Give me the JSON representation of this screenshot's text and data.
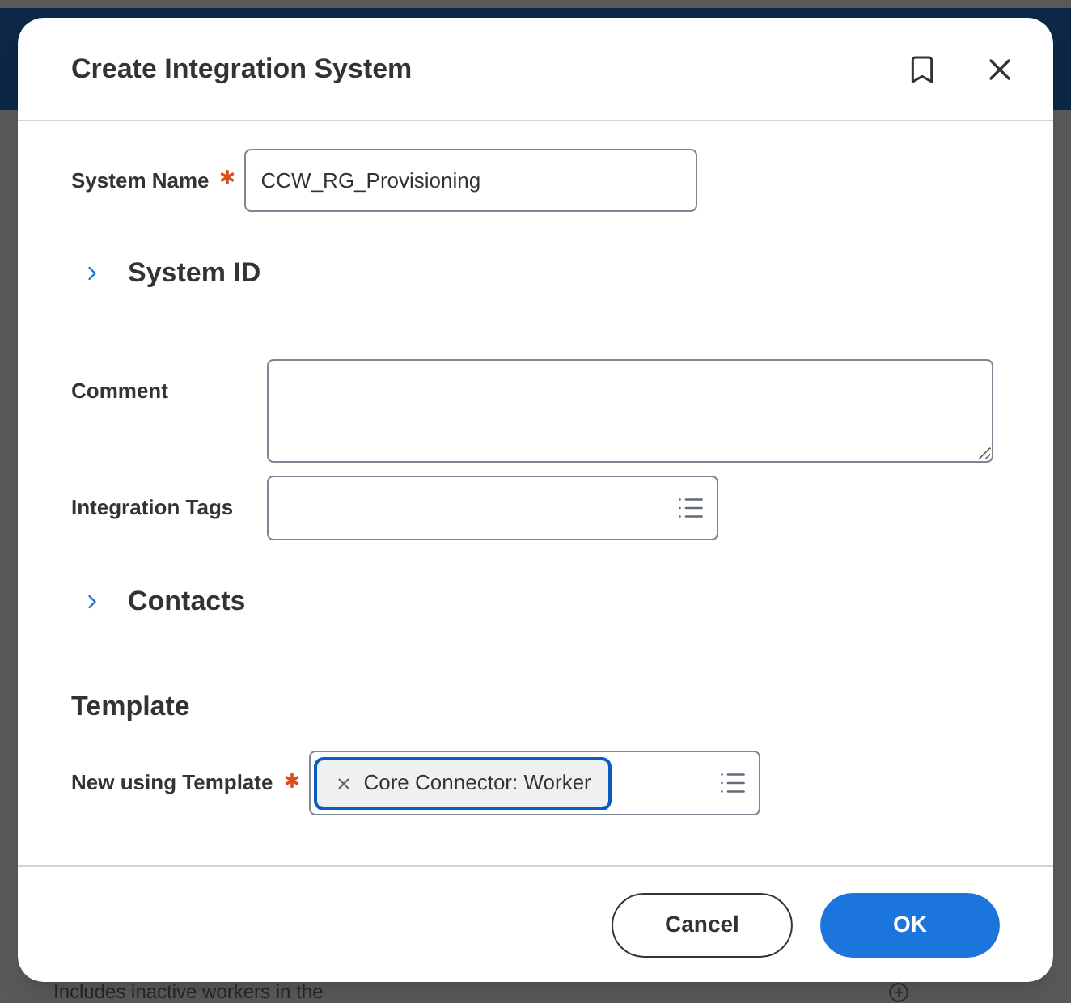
{
  "background": {
    "footer_text": "Includes inactive workers in the"
  },
  "dialog": {
    "title": "Create Integration System"
  },
  "items": [
    {
      "kind": "text_field",
      "label": "System Name",
      "required": true,
      "value": "CCW_RG_Provisioning"
    },
    {
      "kind": "section",
      "label": "System ID",
      "expanded": false
    },
    {
      "kind": "textarea",
      "label": "Comment",
      "required": false
    },
    {
      "kind": "prompt",
      "label": "Integration Tags",
      "required": false
    },
    {
      "kind": "section",
      "label": "Contacts",
      "expanded": false
    },
    {
      "kind": "heading",
      "label": "Template"
    },
    {
      "kind": "prompt",
      "label": "New using Template",
      "required": true,
      "chips": [
        {
          "label": "Core Connector: Worker",
          "selected": true
        }
      ]
    }
  ],
  "buttons": [
    {
      "label": "Cancel",
      "kind": "secondary"
    },
    {
      "label": "OK",
      "kind": "primary"
    }
  ]
}
